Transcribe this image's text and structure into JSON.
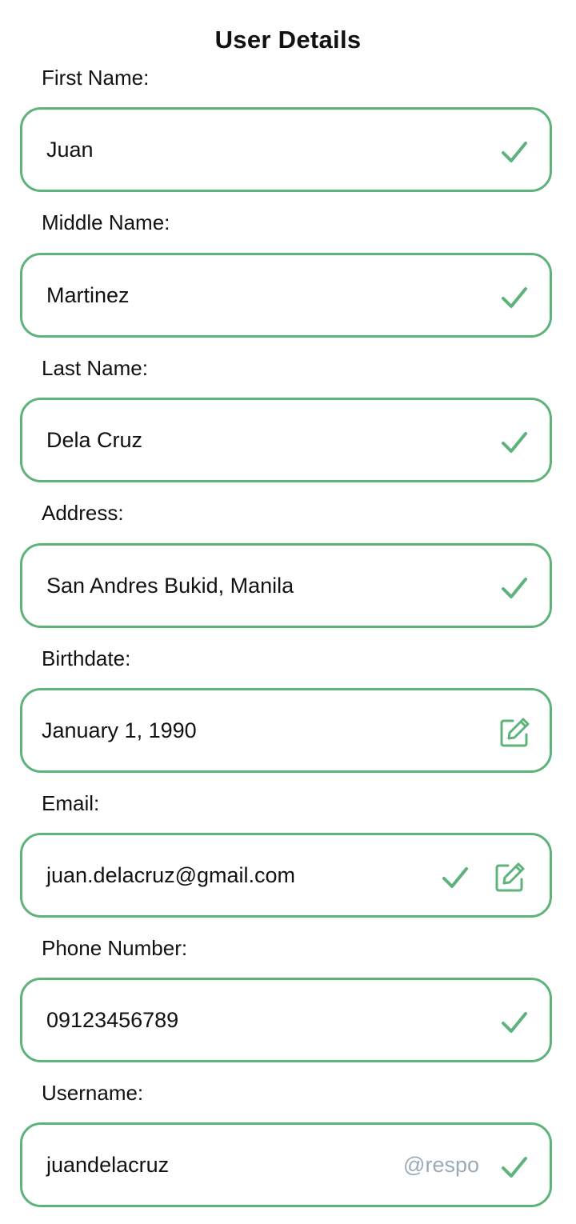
{
  "header": {
    "title": "User Details"
  },
  "fields": {
    "first_name": {
      "label": "First Name:",
      "value": "Juan"
    },
    "middle_name": {
      "label": "Middle Name:",
      "value": "Martinez"
    },
    "last_name": {
      "label": "Last Name:",
      "value": "Dela Cruz"
    },
    "address": {
      "label": "Address:",
      "value": "San Andres Bukid, Manila"
    },
    "birthdate": {
      "label": "Birthdate:",
      "value": "January 1, 1990"
    },
    "email": {
      "label": "Email:",
      "value": "juan.delacruz@gmail.com"
    },
    "phone": {
      "label": "Phone Number:",
      "value": "09123456789"
    },
    "username": {
      "label": "Username:",
      "value": "juandelacruz",
      "suffix": "@respo"
    }
  },
  "icons": {
    "valid": "check-icon",
    "edit": "edit-icon"
  },
  "colors": {
    "accent": "#5db37a",
    "suffix": "#9aaab8",
    "text": "#111111"
  }
}
